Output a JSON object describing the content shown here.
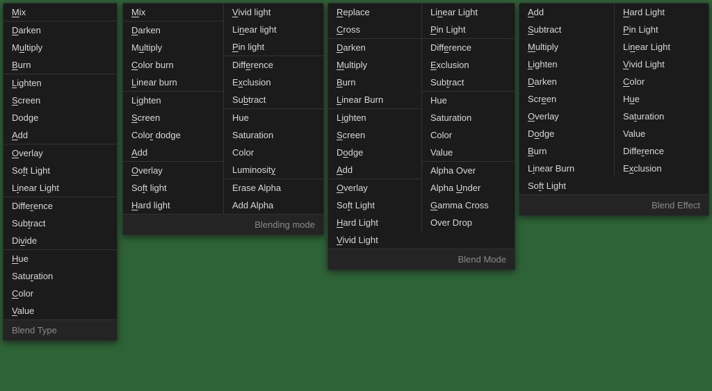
{
  "panel1": {
    "groups": [
      [
        {
          "pre": "",
          "u": "M",
          "post": "ix"
        }
      ],
      [
        {
          "pre": "",
          "u": "D",
          "post": "arken"
        },
        {
          "pre": "M",
          "u": "u",
          "post": "ltiply"
        },
        {
          "pre": "",
          "u": "B",
          "post": "urn"
        }
      ],
      [
        {
          "pre": "",
          "u": "L",
          "post": "ighten"
        },
        {
          "pre": "",
          "u": "S",
          "post": "creen"
        },
        {
          "pre": "Dodge",
          "u": "",
          "post": ""
        },
        {
          "pre": "",
          "u": "A",
          "post": "dd"
        }
      ],
      [
        {
          "pre": "",
          "u": "O",
          "post": "verlay"
        },
        {
          "pre": "So",
          "u": "f",
          "post": "t Light"
        },
        {
          "pre": "L",
          "u": "i",
          "post": "near Light"
        }
      ],
      [
        {
          "pre": "Diffe",
          "u": "r",
          "post": "ence"
        },
        {
          "pre": "Sub",
          "u": "t",
          "post": "ract"
        },
        {
          "pre": "Di",
          "u": "v",
          "post": "ide"
        }
      ],
      [
        {
          "pre": "",
          "u": "H",
          "post": "ue"
        },
        {
          "pre": "Satu",
          "u": "r",
          "post": "ation"
        },
        {
          "pre": "",
          "u": "C",
          "post": "olor"
        },
        {
          "pre": "",
          "u": "V",
          "post": "alue"
        }
      ]
    ],
    "footer": "Blend Type"
  },
  "panel2": {
    "left": [
      [
        {
          "pre": "",
          "u": "M",
          "post": "ix"
        }
      ],
      [
        {
          "pre": "",
          "u": "D",
          "post": "arken"
        },
        {
          "pre": "M",
          "u": "u",
          "post": "ltiply"
        },
        {
          "pre": "",
          "u": "C",
          "post": "olor burn"
        },
        {
          "pre": "",
          "u": "L",
          "post": "inear burn"
        }
      ],
      [
        {
          "pre": "L",
          "u": "i",
          "post": "ghten"
        },
        {
          "pre": "",
          "u": "S",
          "post": "creen"
        },
        {
          "pre": "Colo",
          "u": "r",
          "post": " dodge"
        },
        {
          "pre": "",
          "u": "A",
          "post": "dd"
        }
      ],
      [
        {
          "pre": "",
          "u": "O",
          "post": "verlay"
        },
        {
          "pre": "So",
          "u": "f",
          "post": "t light"
        },
        {
          "pre": "",
          "u": "H",
          "post": "ard light"
        }
      ]
    ],
    "right": [
      [
        {
          "pre": "",
          "u": "V",
          "post": "ivid light"
        },
        {
          "pre": "Li",
          "u": "n",
          "post": "ear light"
        },
        {
          "pre": "",
          "u": "P",
          "post": "in light"
        }
      ],
      [
        {
          "pre": "Diff",
          "u": "e",
          "post": "rence"
        },
        {
          "pre": "E",
          "u": "x",
          "post": "clusion"
        },
        {
          "pre": "Su",
          "u": "b",
          "post": "tract"
        }
      ],
      [
        {
          "pre": "Hue",
          "u": "",
          "post": ""
        },
        {
          "pre": "Saturation",
          "u": "",
          "post": ""
        },
        {
          "pre": "Color",
          "u": "",
          "post": ""
        },
        {
          "pre": "Luminosit",
          "u": "y",
          "post": ""
        }
      ],
      [
        {
          "pre": "Erase Alpha",
          "u": "",
          "post": ""
        },
        {
          "pre": "Add Alpha",
          "u": "",
          "post": ""
        }
      ]
    ],
    "footer": "Blending mode"
  },
  "panel3": {
    "left": [
      [
        {
          "pre": "",
          "u": "R",
          "post": "eplace"
        },
        {
          "pre": "",
          "u": "C",
          "post": "ross"
        }
      ],
      [
        {
          "pre": "",
          "u": "D",
          "post": "arken"
        },
        {
          "pre": "",
          "u": "M",
          "post": "ultiply"
        },
        {
          "pre": "",
          "u": "B",
          "post": "urn"
        },
        {
          "pre": "",
          "u": "L",
          "post": "inear Burn"
        }
      ],
      [
        {
          "pre": "L",
          "u": "i",
          "post": "ghten"
        },
        {
          "pre": "",
          "u": "S",
          "post": "creen"
        },
        {
          "pre": "D",
          "u": "o",
          "post": "dge"
        },
        {
          "pre": "",
          "u": "A",
          "post": "dd"
        }
      ],
      [
        {
          "pre": "",
          "u": "O",
          "post": "verlay"
        },
        {
          "pre": "So",
          "u": "f",
          "post": "t Light"
        },
        {
          "pre": "",
          "u": "H",
          "post": "ard Light"
        },
        {
          "pre": "",
          "u": "V",
          "post": "ivid Light"
        }
      ]
    ],
    "right": [
      [
        {
          "pre": "Li",
          "u": "n",
          "post": "ear Light"
        },
        {
          "pre": "",
          "u": "P",
          "post": "in Light"
        }
      ],
      [
        {
          "pre": "Diff",
          "u": "e",
          "post": "rence"
        },
        {
          "pre": "",
          "u": "E",
          "post": "xclusion"
        },
        {
          "pre": "Sub",
          "u": "t",
          "post": "ract"
        }
      ],
      [
        {
          "pre": "Hue",
          "u": "",
          "post": ""
        },
        {
          "pre": "Saturation",
          "u": "",
          "post": ""
        },
        {
          "pre": "Color",
          "u": "",
          "post": ""
        },
        {
          "pre": "Value",
          "u": "",
          "post": ""
        }
      ],
      [
        {
          "pre": "Alpha Over",
          "u": "",
          "post": ""
        },
        {
          "pre": "Alpha ",
          "u": "U",
          "post": "nder"
        },
        {
          "pre": "",
          "u": "G",
          "post": "amma Cross"
        },
        {
          "pre": "Over Drop",
          "u": "",
          "post": ""
        }
      ]
    ],
    "footer": "Blend Mode"
  },
  "panel4": {
    "left": [
      [
        {
          "pre": "",
          "u": "A",
          "post": "dd"
        },
        {
          "pre": "",
          "u": "S",
          "post": "ubtract"
        },
        {
          "pre": "",
          "u": "M",
          "post": "ultiply"
        },
        {
          "pre": "",
          "u": "L",
          "post": "ighten"
        },
        {
          "pre": "",
          "u": "D",
          "post": "arken"
        },
        {
          "pre": "Scr",
          "u": "e",
          "post": "en"
        },
        {
          "pre": "",
          "u": "O",
          "post": "verlay"
        },
        {
          "pre": "D",
          "u": "o",
          "post": "dge"
        },
        {
          "pre": "",
          "u": "B",
          "post": "urn"
        },
        {
          "pre": "L",
          "u": "i",
          "post": "near Burn"
        },
        {
          "pre": "So",
          "u": "f",
          "post": "t Light"
        }
      ]
    ],
    "right": [
      [
        {
          "pre": "",
          "u": "H",
          "post": "ard Light"
        },
        {
          "pre": "",
          "u": "P",
          "post": "in Light"
        },
        {
          "pre": "Li",
          "u": "n",
          "post": "ear Light"
        },
        {
          "pre": "",
          "u": "V",
          "post": "ivid Light"
        },
        {
          "pre": "",
          "u": "C",
          "post": "olor"
        },
        {
          "pre": "H",
          "u": "u",
          "post": "e"
        },
        {
          "pre": "Sa",
          "u": "t",
          "post": "uration"
        },
        {
          "pre": "Value",
          "u": "",
          "post": ""
        },
        {
          "pre": "Diffe",
          "u": "r",
          "post": "ence"
        },
        {
          "pre": "E",
          "u": "x",
          "post": "clusion"
        }
      ]
    ],
    "footer": "Blend Effect"
  }
}
